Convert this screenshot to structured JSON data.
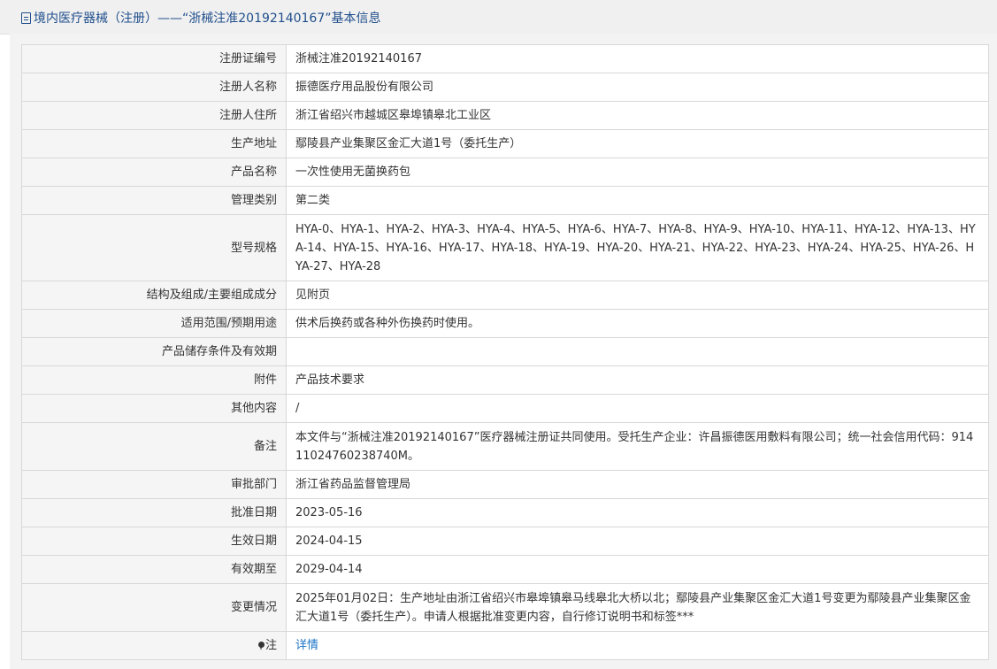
{
  "header": {
    "title": "境内医疗器械（注册）——“浙械注准20192140167”基本信息",
    "icon": "document-icon"
  },
  "rows": [
    {
      "label": "注册证编号",
      "value": "浙械注准20192140167"
    },
    {
      "label": "注册人名称",
      "value": "振德医疗用品股份有限公司"
    },
    {
      "label": "注册人住所",
      "value": "浙江省绍兴市越城区皋埠镇皋北工业区"
    },
    {
      "label": "生产地址",
      "value": "鄢陵县产业集聚区金汇大道1号（委托生产）"
    },
    {
      "label": "产品名称",
      "value": "一次性使用无菌换药包"
    },
    {
      "label": "管理类别",
      "value": "第二类"
    },
    {
      "label": "型号规格",
      "value": "HYA-0、HYA-1、HYA-2、HYA-3、HYA-4、HYA-5、HYA-6、HYA-7、HYA-8、HYA-9、HYA-10、HYA-11、HYA-12、HYA-13、HYA-14、HYA-15、HYA-16、HYA-17、HYA-18、HYA-19、HYA-20、HYA-21、HYA-22、HYA-23、HYA-24、HYA-25、HYA-26、HYA-27、HYA-28"
    },
    {
      "label": "结构及组成/主要组成成分",
      "value": "见附页"
    },
    {
      "label": "适用范围/预期用途",
      "value": "供术后换药或各种外伤换药时使用。"
    },
    {
      "label": "产品储存条件及有效期",
      "value": ""
    },
    {
      "label": "附件",
      "value": "产品技术要求"
    },
    {
      "label": "其他内容",
      "value": "/"
    },
    {
      "label": "备注",
      "value": "本文件与“浙械注准20192140167”医疗器械注册证共同使用。受托生产企业：许昌振德医用敷料有限公司；统一社会信用代码：91411024760238740M。"
    },
    {
      "label": "审批部门",
      "value": "浙江省药品监督管理局"
    },
    {
      "label": "批准日期",
      "value": "2023-05-16"
    },
    {
      "label": "生效日期",
      "value": "2024-04-15"
    },
    {
      "label": "有效期至",
      "value": "2029-04-14"
    },
    {
      "label": "变更情况",
      "value": "2025年01月02日：生产地址由浙江省绍兴市皋埠镇皋马线皋北大桥以北；鄢陵县产业集聚区金汇大道1号变更为鄢陵县产业集聚区金汇大道1号（委托生产）。申请人根据批准变更内容，自行修订说明书和标签***"
    }
  ],
  "note_row": {
    "icon": "pin-icon",
    "label": "注",
    "link": "详情"
  }
}
